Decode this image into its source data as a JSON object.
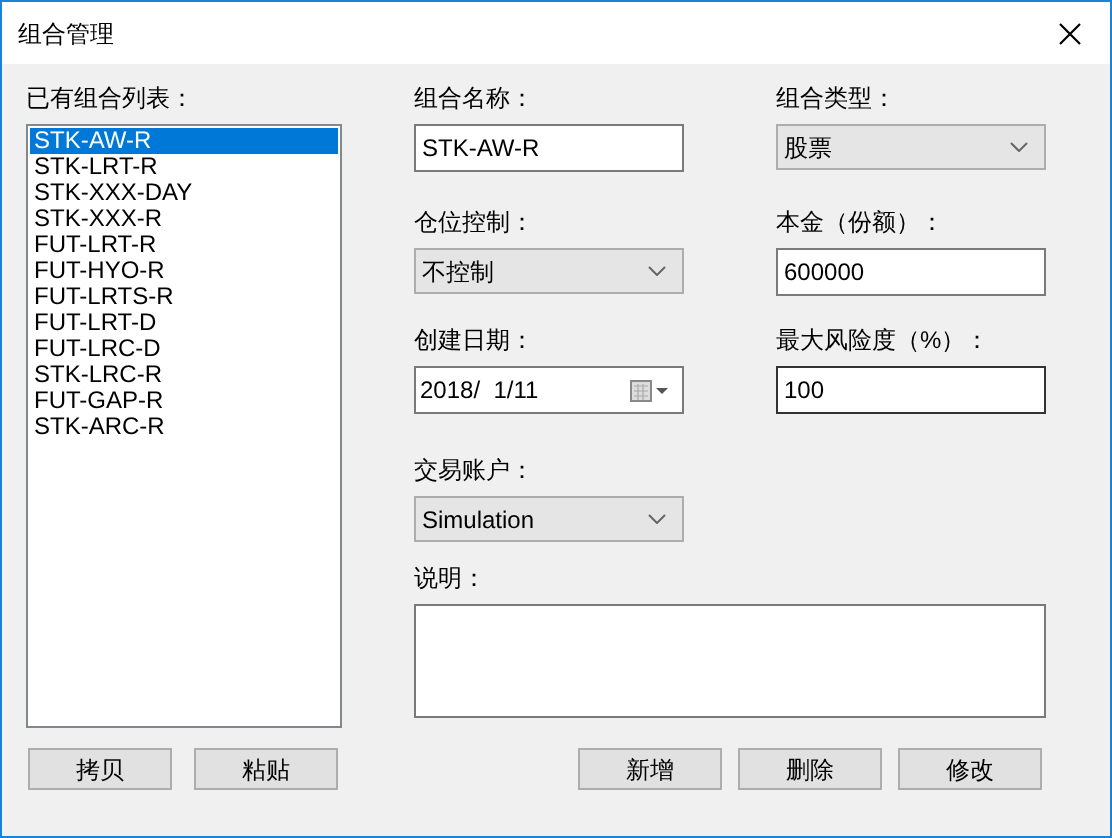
{
  "window": {
    "title": "组合管理"
  },
  "portfolio_list": {
    "label": "已有组合列表：",
    "items": [
      {
        "text": "STK-AW-R",
        "selected": true
      },
      {
        "text": "STK-LRT-R",
        "selected": false
      },
      {
        "text": "STK-XXX-DAY",
        "selected": false
      },
      {
        "text": "STK-XXX-R",
        "selected": false
      },
      {
        "text": "FUT-LRT-R",
        "selected": false
      },
      {
        "text": "FUT-HYO-R",
        "selected": false
      },
      {
        "text": "FUT-LRTS-R",
        "selected": false
      },
      {
        "text": "FUT-LRT-D",
        "selected": false
      },
      {
        "text": "FUT-LRC-D",
        "selected": false
      },
      {
        "text": "STK-LRC-R",
        "selected": false
      },
      {
        "text": "FUT-GAP-R",
        "selected": false
      },
      {
        "text": "STK-ARC-R",
        "selected": false
      }
    ]
  },
  "fields": [
    {
      "kind": "text",
      "label": "组合名称：",
      "value": "STK-AW-R",
      "focused": false
    },
    {
      "kind": "combo",
      "label": "组合类型：",
      "value": "股票"
    },
    {
      "kind": "combo",
      "label": "仓位控制：",
      "value": "不控制"
    },
    {
      "kind": "text",
      "label": "本金（份额）：",
      "value": "600000",
      "focused": false
    },
    {
      "kind": "date",
      "label": "创建日期：",
      "value": "2018/  1/11"
    },
    {
      "kind": "text",
      "label": "最大风险度（%）：",
      "value": "100",
      "focused": true
    },
    {
      "kind": "combo",
      "label": "交易账户：",
      "value": "Simulation"
    },
    {
      "kind": "note",
      "label": "说明："
    }
  ],
  "left_buttons": [
    "拷贝",
    "粘贴"
  ],
  "right_buttons": [
    "新增",
    "删除",
    "修改"
  ]
}
